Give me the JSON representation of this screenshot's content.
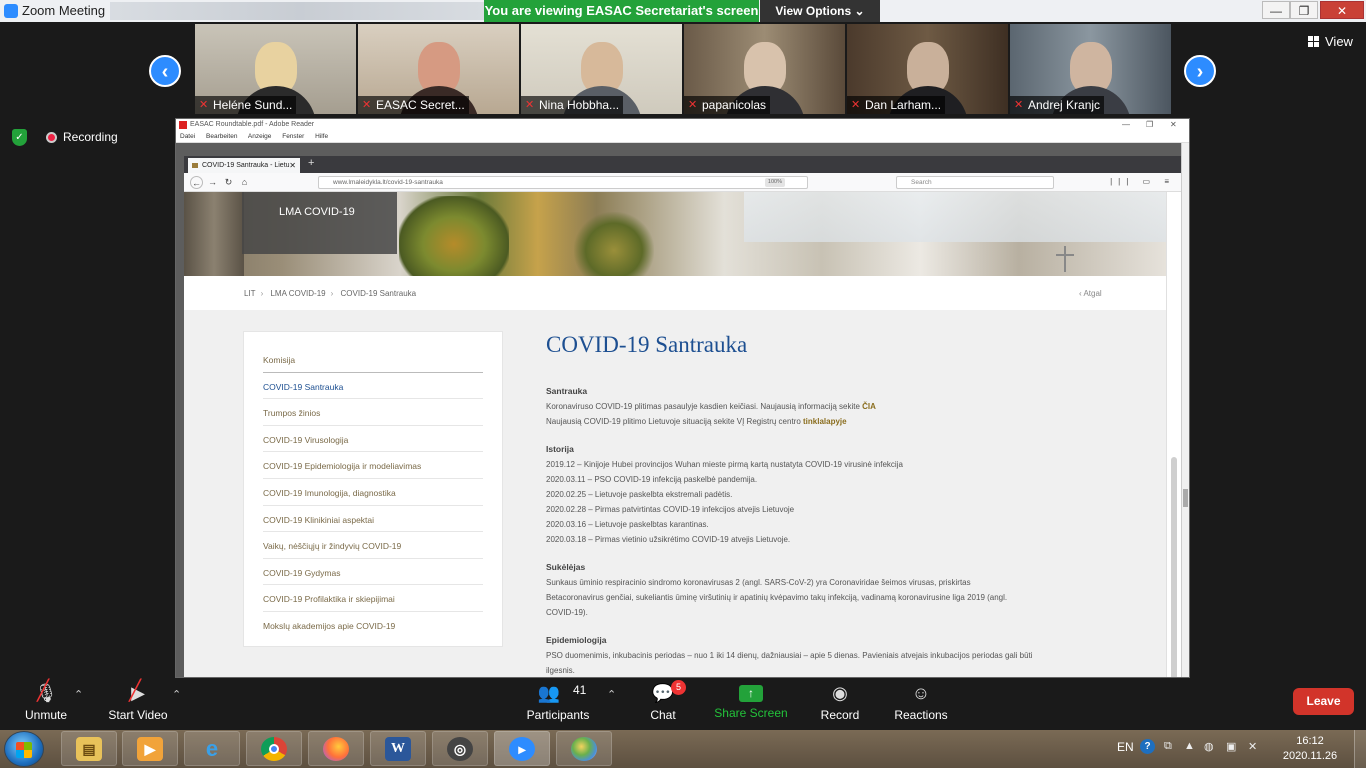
{
  "zoom": {
    "window_title": "Zoom Meeting",
    "viewing_banner": "You are viewing EASAC Secretariat's screen",
    "view_options": "View Options",
    "view_label": "View",
    "recording_label": "Recording",
    "participants_thumbs": [
      {
        "name": "Heléne Sund..."
      },
      {
        "name": "EASAC Secret..."
      },
      {
        "name": "Nina Hobbha..."
      },
      {
        "name": "papanicolas"
      },
      {
        "name": "Dan Larham..."
      },
      {
        "name": "Andrej Kranjc"
      }
    ]
  },
  "adobe": {
    "title": "EASAC Roundtable.pdf - Adobe Reader",
    "menu": [
      "Datei",
      "Bearbeiten",
      "Anzeige",
      "Fenster",
      "Hilfe"
    ]
  },
  "browser": {
    "tab_title": "COVID-19 Santrauka - Lietu",
    "url": "www.lmaleidykla.lt/covid-19-santrauka",
    "zoom_level": "100%",
    "search_placeholder": "Search"
  },
  "site": {
    "hero_title": "LMA COVID-19",
    "breadcrumbs": [
      "LIT",
      "LMA COVID-19",
      "COVID-19 Santrauka"
    ],
    "back_label": "Atgal",
    "sidebar": [
      "Komisija",
      "COVID-19 Santrauka",
      "Trumpos žinios",
      "COVID-19 Virusologija",
      "COVID-19 Epidemiologija ir modeliavimas",
      "COVID-19 Imunologija, diagnostika",
      "COVID-19 Klinikiniai aspektai",
      "Vaikų, nėščiųjų ir žindyvių COVID-19",
      "COVID-19 Gydymas",
      "COVID-19 Profilaktika ir skiepijimai",
      "Mokslų akademijos apie COVID-19"
    ],
    "page_title": "COVID-19 Santrauka",
    "sections": {
      "santrauka_title": "Santrauka",
      "santrauka_l1": "Koronaviruso COVID-19 plitimas pasaulyje kasdien keičiasi. Naujausią informaciją sekite",
      "santrauka_l1_link": "ČIA",
      "santrauka_l2": "Naujausią COVID-19 plitimo Lietuvoje situaciją sekite VĮ Registrų centro",
      "santrauka_l2_link": "tinklalapyje",
      "istorija_title": "Istorija",
      "istorija": [
        "2019.12 – Kinijoje Hubei provincijos Wuhan mieste pirmą kartą nustatyta COVID-19 virusinė infekcija",
        "2020.03.11 – PSO COVID-19 infekciją paskelbė pandemija.",
        "2020.02.25 – Lietuvoje paskelbta ekstremali padėtis.",
        "2020.02.28 – Pirmas patvirtintas COVID-19 infekcijos atvejis Lietuvoje",
        "2020.03.16 – Lietuvoje paskelbtas karantinas.",
        "2020.03.18 – Pirmas vietinio užsikrėtimo COVID-19 atvejis Lietuvoje."
      ],
      "sukelejas_title": "Sukėlėjas",
      "sukelejas": [
        "Sunkaus ūminio respiracinio sindromo koronavirusas 2 (angl. SARS-CoV-2) yra  Coronaviridae šeimos virusas, priskirtas",
        "Betacoronavirus genčiai, sukeliantis ūminę viršutinių ir apatinių kvėpavimo takų infekciją, vadinamą koronavirusine liga 2019 (angl.",
        "COVID-19)."
      ],
      "epidemiologija_title": "Epidemiologija",
      "epidemiologija": [
        "PSO duomenimis, inkubacinis periodas – nuo 1 iki 14 dienų, dažniausiai – apie 5 dienas. Pavieniais atvejais inkubacijos periodas gali būti",
        "ilgesnis."
      ]
    }
  },
  "toolbar": {
    "unmute": "Unmute",
    "start_video": "Start Video",
    "participants": "Participants",
    "participants_count": "41",
    "chat": "Chat",
    "chat_badge": "5",
    "share_screen": "Share Screen",
    "record": "Record",
    "reactions": "Reactions",
    "leave": "Leave"
  },
  "taskbar": {
    "language": "EN",
    "time": "16:12",
    "date": "2020.11.26"
  }
}
